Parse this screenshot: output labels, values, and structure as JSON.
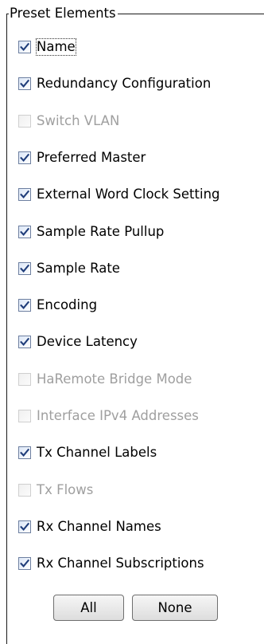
{
  "group": {
    "title": "Preset Elements"
  },
  "options": [
    {
      "label": "Name",
      "checked": true,
      "enabled": true,
      "focused": true
    },
    {
      "label": "Redundancy Configuration",
      "checked": true,
      "enabled": true
    },
    {
      "label": "Switch VLAN",
      "checked": false,
      "enabled": false
    },
    {
      "label": "Preferred Master",
      "checked": true,
      "enabled": true
    },
    {
      "label": "External Word Clock Setting",
      "checked": true,
      "enabled": true
    },
    {
      "label": "Sample Rate Pullup",
      "checked": true,
      "enabled": true
    },
    {
      "label": "Sample Rate",
      "checked": true,
      "enabled": true
    },
    {
      "label": "Encoding",
      "checked": true,
      "enabled": true
    },
    {
      "label": "Device Latency",
      "checked": true,
      "enabled": true
    },
    {
      "label": "HaRemote Bridge Mode",
      "checked": false,
      "enabled": false
    },
    {
      "label": "Interface IPv4 Addresses",
      "checked": false,
      "enabled": false
    },
    {
      "label": "Tx Channel Labels",
      "checked": true,
      "enabled": true
    },
    {
      "label": "Tx Flows",
      "checked": false,
      "enabled": false
    },
    {
      "label": "Rx Channel Names",
      "checked": true,
      "enabled": true
    },
    {
      "label": "Rx Channel Subscriptions",
      "checked": true,
      "enabled": true
    }
  ],
  "buttons": {
    "all_label": "All",
    "none_label": "None"
  },
  "colors": {
    "checkmark": "#1f3d7a",
    "disabled_text": "#9f9f9f"
  }
}
